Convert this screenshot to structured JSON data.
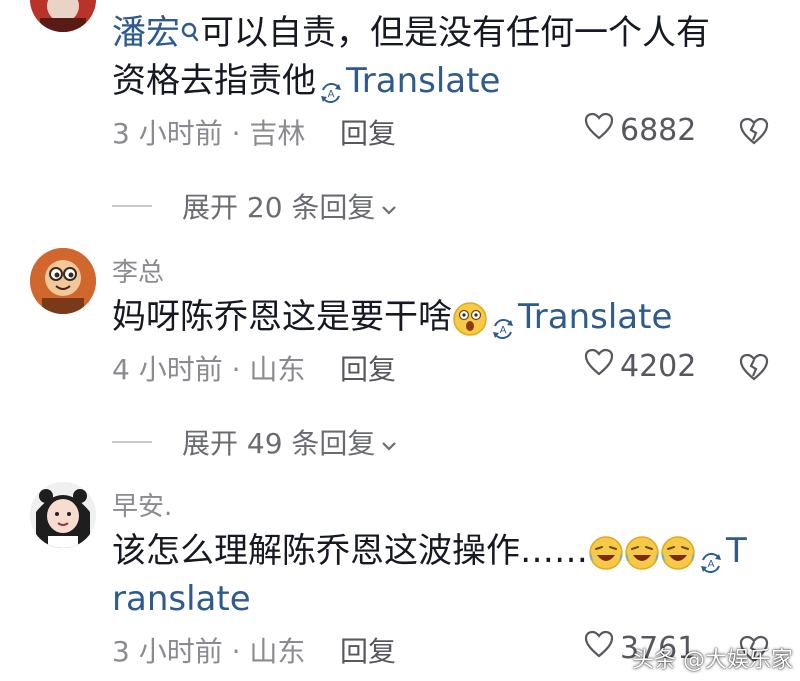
{
  "comments": [
    {
      "username": "潘宏",
      "text": "可以自责，但是没有任何一个人有",
      "text_line2": "资格去指责他",
      "translate_label": "Translate",
      "time_location": "3 小时前 · 吉林",
      "reply_label": "回复",
      "like_count": "6882",
      "expand_label": "展开 20 条回复"
    },
    {
      "username": "李总",
      "text": "妈呀陈乔恩这是要干啥",
      "translate_label": "Translate",
      "time_location": "4 小时前 · 山东",
      "reply_label": "回复",
      "like_count": "4202",
      "expand_label": "展开 49 条回复"
    },
    {
      "username": "早安.",
      "text": "该怎么理解陈乔恩这波操作……",
      "translate_label_part1": "T",
      "translate_label_part2": "ranslate",
      "time_location": "3 小时前 · 山东",
      "reply_label": "回复",
      "like_count": "3761"
    }
  ],
  "watermark": "头条 @大娱乐家",
  "icons": {
    "search": "search-icon",
    "translate": "translate-icon",
    "heart": "heart-icon",
    "broken_heart": "dislike-icon",
    "chevron": "chevron-down-icon"
  }
}
